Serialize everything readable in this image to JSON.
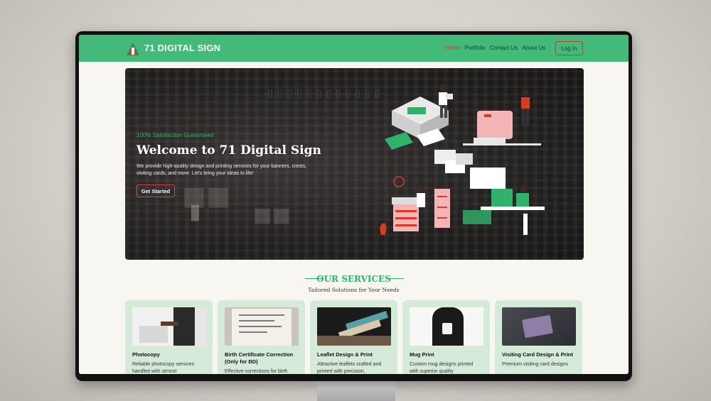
{
  "brand": {
    "name": "71 DIGITAL SIGN"
  },
  "nav": {
    "items": [
      {
        "label": "Home",
        "active": true
      },
      {
        "label": "Portfolio",
        "active": false
      },
      {
        "label": "Contact Us",
        "active": false
      },
      {
        "label": "About Us",
        "active": false
      }
    ],
    "login_label": "Log In"
  },
  "hero": {
    "tagline": "100% Satisfaction Guaranteed",
    "title": "Welcome to 71 Digital Sign",
    "description": "We provide high-quality design and printing services for your banners, crests, visiting cards, and more. Let's bring your ideas to life!",
    "cta_label": "Get Started"
  },
  "services": {
    "title": "OUR SERVICES",
    "subtitle": "Tailored Solutions for Your Needs",
    "cards": [
      {
        "title": "Photocopy",
        "description": "Reliable photocopy services handled with utmost"
      },
      {
        "title": "Birth Certificate Correction (Only for BD)",
        "description": "Effective corrections for birth"
      },
      {
        "title": "Leaflet Design & Print",
        "description": "Attractive leaflets crafted and printed with precision."
      },
      {
        "title": "Mug Print",
        "description": "Custom mug designs printed with superior quality"
      },
      {
        "title": "Visiting Card Design & Print",
        "description": "Premium visiting card designs"
      }
    ]
  },
  "colors": {
    "accent": "#43b97a",
    "brand_green": "#2fb36b",
    "active_red": "#d93a24"
  }
}
